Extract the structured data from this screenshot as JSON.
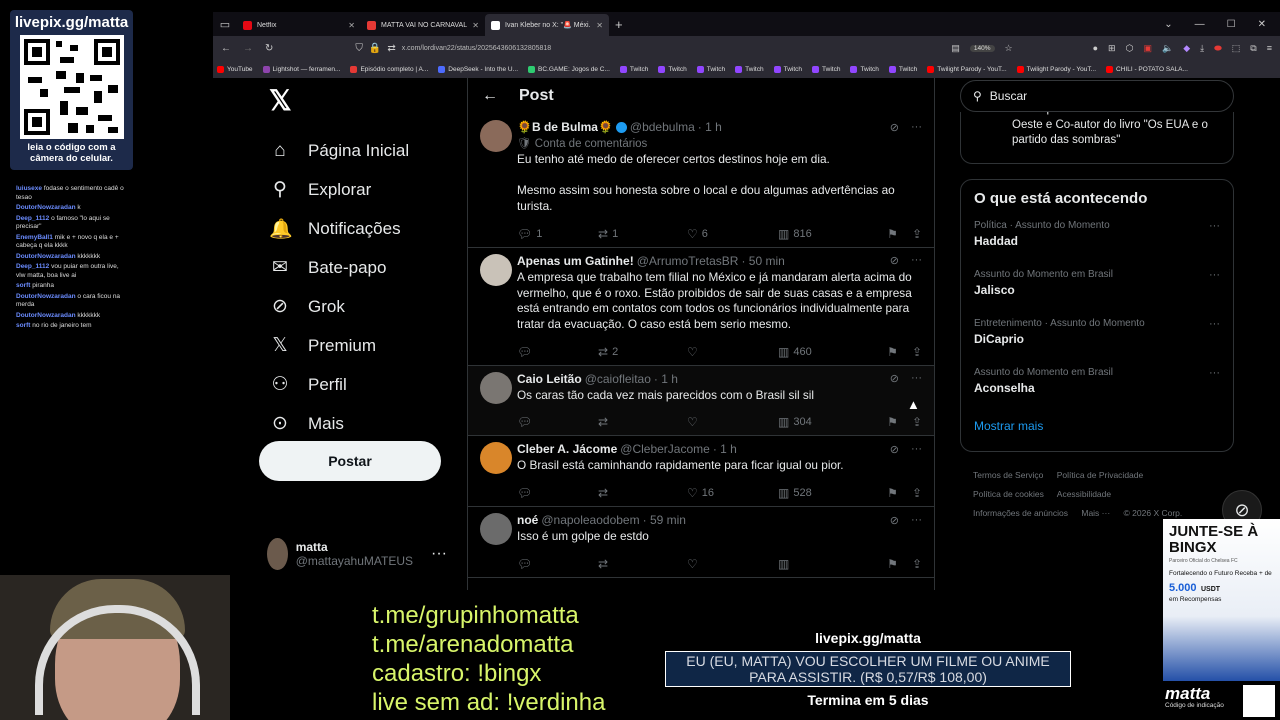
{
  "overlay": {
    "qr_title": "livepix.gg/matta",
    "qr_caption": "leia o código com a câmera do celular.",
    "chat": [
      {
        "user": "luiusexe",
        "text": "fodase o sentimento cadê o tesao"
      },
      {
        "user": "DoutorNowzaradan",
        "text": "k"
      },
      {
        "user": "Deep_1112",
        "text": "o famoso \"lo aqui se precisar\""
      },
      {
        "user": "EnemyBall1",
        "text": "mik e + novo q ela e + cabeça q ela kkkk"
      },
      {
        "user": "DoutorNowzaradan",
        "text": "kkkkkkk"
      },
      {
        "user": "Deep_1112",
        "text": "vou puiar em outra live, vlw matta, boa live ai"
      },
      {
        "user": "sorft",
        "text": "piranha"
      },
      {
        "user": "DoutorNowzaradan",
        "text": "o cara ficou na merda"
      },
      {
        "user": "DoutorNowzaradan",
        "text": "kkkkkkk"
      },
      {
        "user": "sorft",
        "text": "no rio de janeiro tem"
      }
    ],
    "links": [
      "t.me/grupinhomatta",
      "t.me/arenadomatta",
      "cadastro: !bingx",
      "live sem ad: !verdinha"
    ],
    "livepix_title": "livepix.gg/matta",
    "livepix_goal": "EU (EU, MATTA) VOU ESCOLHER UM FILME OU ANIME PARA ASSISTIR. (R$ 0,57/R$ 108,00)",
    "livepix_end": "Termina em 5 dias",
    "ad": {
      "headline": "JUNTE-SE À BINGX",
      "sub": "Parceiro Oficial do Chelsea FC",
      "promo": "Fortalecendo o Futuro Receba + de",
      "amount": "5.000",
      "currency": "USDT",
      "rewards": "em Recompensas"
    },
    "brand": "matta",
    "brand_caption": "Código de indicação"
  },
  "browser": {
    "tabs": [
      {
        "label": "Netflix",
        "color": "#e50914",
        "active": false
      },
      {
        "label": "MATTA VAI NO CARNAVAL DE ...",
        "color": "#e53935",
        "active": false
      },
      {
        "label": "Ivan Kleber no X: \"🚨 Méxi...",
        "color": "#ffffff",
        "active": true
      }
    ],
    "url": "x.com/lordivan22/status/2025643606132805818",
    "zoom": "140%",
    "bookmarks": [
      {
        "label": "YouTube",
        "color": "#ff0000"
      },
      {
        "label": "Lightshot — ferramen...",
        "color": "#8e44ad"
      },
      {
        "label": "Episódio completo | A...",
        "color": "#e53935"
      },
      {
        "label": "DeepSeek - Into the U...",
        "color": "#4d6bfe"
      },
      {
        "label": "BC.GAME: Jogos de C...",
        "color": "#2ecc71"
      },
      {
        "label": "Twitch",
        "color": "#9146ff"
      },
      {
        "label": "Twitch",
        "color": "#9146ff"
      },
      {
        "label": "Twitch",
        "color": "#9146ff"
      },
      {
        "label": "Twitch",
        "color": "#9146ff"
      },
      {
        "label": "Twitch",
        "color": "#9146ff"
      },
      {
        "label": "Twitch",
        "color": "#9146ff"
      },
      {
        "label": "Twitch",
        "color": "#9146ff"
      },
      {
        "label": "Twitch",
        "color": "#9146ff"
      },
      {
        "label": "Twilight Parody - YouT...",
        "color": "#ff0000"
      },
      {
        "label": "Twilight Parody - YouT...",
        "color": "#ff0000"
      },
      {
        "label": "CHILI - POTATO SALA...",
        "color": "#ff0000"
      }
    ]
  },
  "nav": {
    "items": [
      {
        "label": "Página Inicial",
        "icon": "⌂"
      },
      {
        "label": "Explorar",
        "icon": "⚲"
      },
      {
        "label": "Notificações",
        "icon": "🔔"
      },
      {
        "label": "Bate-papo",
        "icon": "✉"
      },
      {
        "label": "Grok",
        "icon": "⊘"
      },
      {
        "label": "Premium",
        "icon": "𝕏"
      },
      {
        "label": "Perfil",
        "icon": "👤"
      },
      {
        "label": "Mais",
        "icon": "⋯"
      }
    ],
    "post_label": "Postar",
    "account_name": "matta",
    "account_handle": "@mattayahuMATEUS"
  },
  "main": {
    "header": "Post",
    "tweets": [
      {
        "name": "🌻B de Bulma🌻",
        "handle": "@bdebulma",
        "time": "· 1 h",
        "verified": true,
        "badge": "🛡 Conta de comentários",
        "text": "Eu tenho até medo de oferecer certos destinos hoje em dia.\n\nMesmo assim sou honesta sobre o local e dou algumas advertências ao turista.",
        "replies": "1",
        "retweets": "1",
        "likes": "6",
        "views": "816",
        "avatar": "#8a6a5a"
      },
      {
        "name": "Apenas um Gatinhe!",
        "handle": "@ArrumoTretasBR",
        "time": "· 50 min",
        "verified": false,
        "badge": "",
        "text": "A empresa que trabalho tem filial no México e já mandaram alerta acima do vermelho, que é o roxo. Estão proibidos de sair de suas casas e a empresa está entrando em contatos com todos os funcionários individualmente para tratar da evacuação. O caso está bem serio mesmo.",
        "replies": "",
        "retweets": "2",
        "likes": "",
        "views": "460",
        "avatar": "#c9c2b8"
      },
      {
        "name": "Caio Leitão",
        "handle": "@caiofleitao",
        "time": "· 1 h",
        "verified": false,
        "badge": "",
        "text": "Os caras tão cada vez mais parecidos com o Brasil sil sil",
        "replies": "",
        "retweets": "",
        "likes": "",
        "views": "304",
        "avatar": "#7a7672"
      },
      {
        "name": "Cleber A. Jácome",
        "handle": "@CleberJacome",
        "time": "· 1 h",
        "verified": false,
        "badge": "",
        "text": "O Brasil está caminhando rapidamente para ficar igual ou pior.",
        "replies": "",
        "retweets": "",
        "likes": "16",
        "views": "528",
        "avatar": "#d9862a"
      },
      {
        "name": "noé",
        "handle": "@napoleaodobem",
        "time": "· 59 min",
        "verified": false,
        "badge": "",
        "text": "Isso é um golpe de estdo",
        "replies": "",
        "retweets": "",
        "likes": "",
        "views": "",
        "avatar": "#6b6b6b"
      }
    ]
  },
  "right": {
    "search_placeholder": "Buscar",
    "top_box_text": "Correspondente internacional revista Oeste e Co-autor do livro \"Os EUA e o partido das sombras\"",
    "trends_title": "O que está acontecendo",
    "trends": [
      {
        "context": "Política · Assunto do Momento",
        "title": "Haddad"
      },
      {
        "context": "Assunto do Momento em Brasil",
        "title": "Jalisco"
      },
      {
        "context": "Entretenimento · Assunto do Momento",
        "title": "DiCaprio"
      },
      {
        "context": "Assunto do Momento em Brasil",
        "title": "Aconselha"
      }
    ],
    "show_more": "Mostrar mais",
    "footer": [
      "Termos de Serviço",
      "Política de Privacidade",
      "Política de cookies",
      "Acessibilidade",
      "Informações de anúncios",
      "Mais ···",
      "© 2026 X Corp."
    ]
  }
}
